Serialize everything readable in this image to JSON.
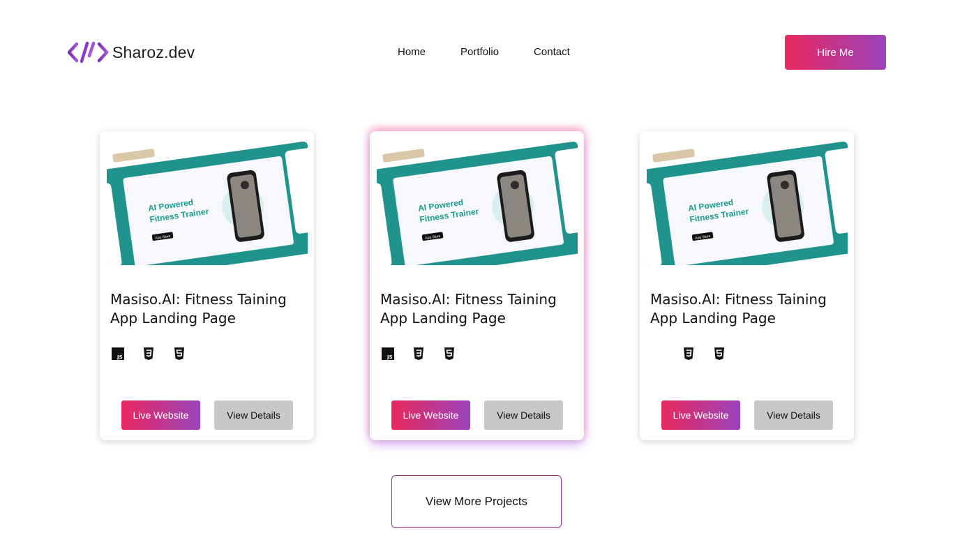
{
  "brand": {
    "name": "Sharoz.dev",
    "logo_icon": "code-brackets-icon",
    "accent_start": "#e8295f",
    "accent_end": "#9a43b9"
  },
  "nav": {
    "items": [
      "Home",
      "Portfolio",
      "Contact"
    ]
  },
  "header": {
    "hire_label": "Hire Me"
  },
  "projects": [
    {
      "title": "Masiso.AI: Fitness Taining App Landing Page",
      "preview": {
        "headline_1": "AI Powered",
        "headline_2": "Fitness Trainer",
        "badge": "App Store"
      },
      "tech": [
        "js",
        "css3",
        "html5"
      ],
      "live_label": "Live Website",
      "details_label": "View Details"
    },
    {
      "title": "Masiso.AI: Fitness Taining App Landing Page",
      "preview": {
        "headline_1": "AI Powered",
        "headline_2": "Fitness Trainer",
        "badge": "App Store"
      },
      "tech": [
        "js",
        "css3",
        "html5"
      ],
      "live_label": "Live Website",
      "details_label": "View Details"
    },
    {
      "title": "Masiso.AI: Fitness Taining App Landing Page",
      "preview": {
        "headline_1": "AI Powered",
        "headline_2": "Fitness Trainer",
        "badge": "App Store"
      },
      "tech": [
        "css3",
        "html5"
      ],
      "live_label": "Live Website",
      "details_label": "View Details"
    }
  ],
  "more_label": "View More Projects"
}
